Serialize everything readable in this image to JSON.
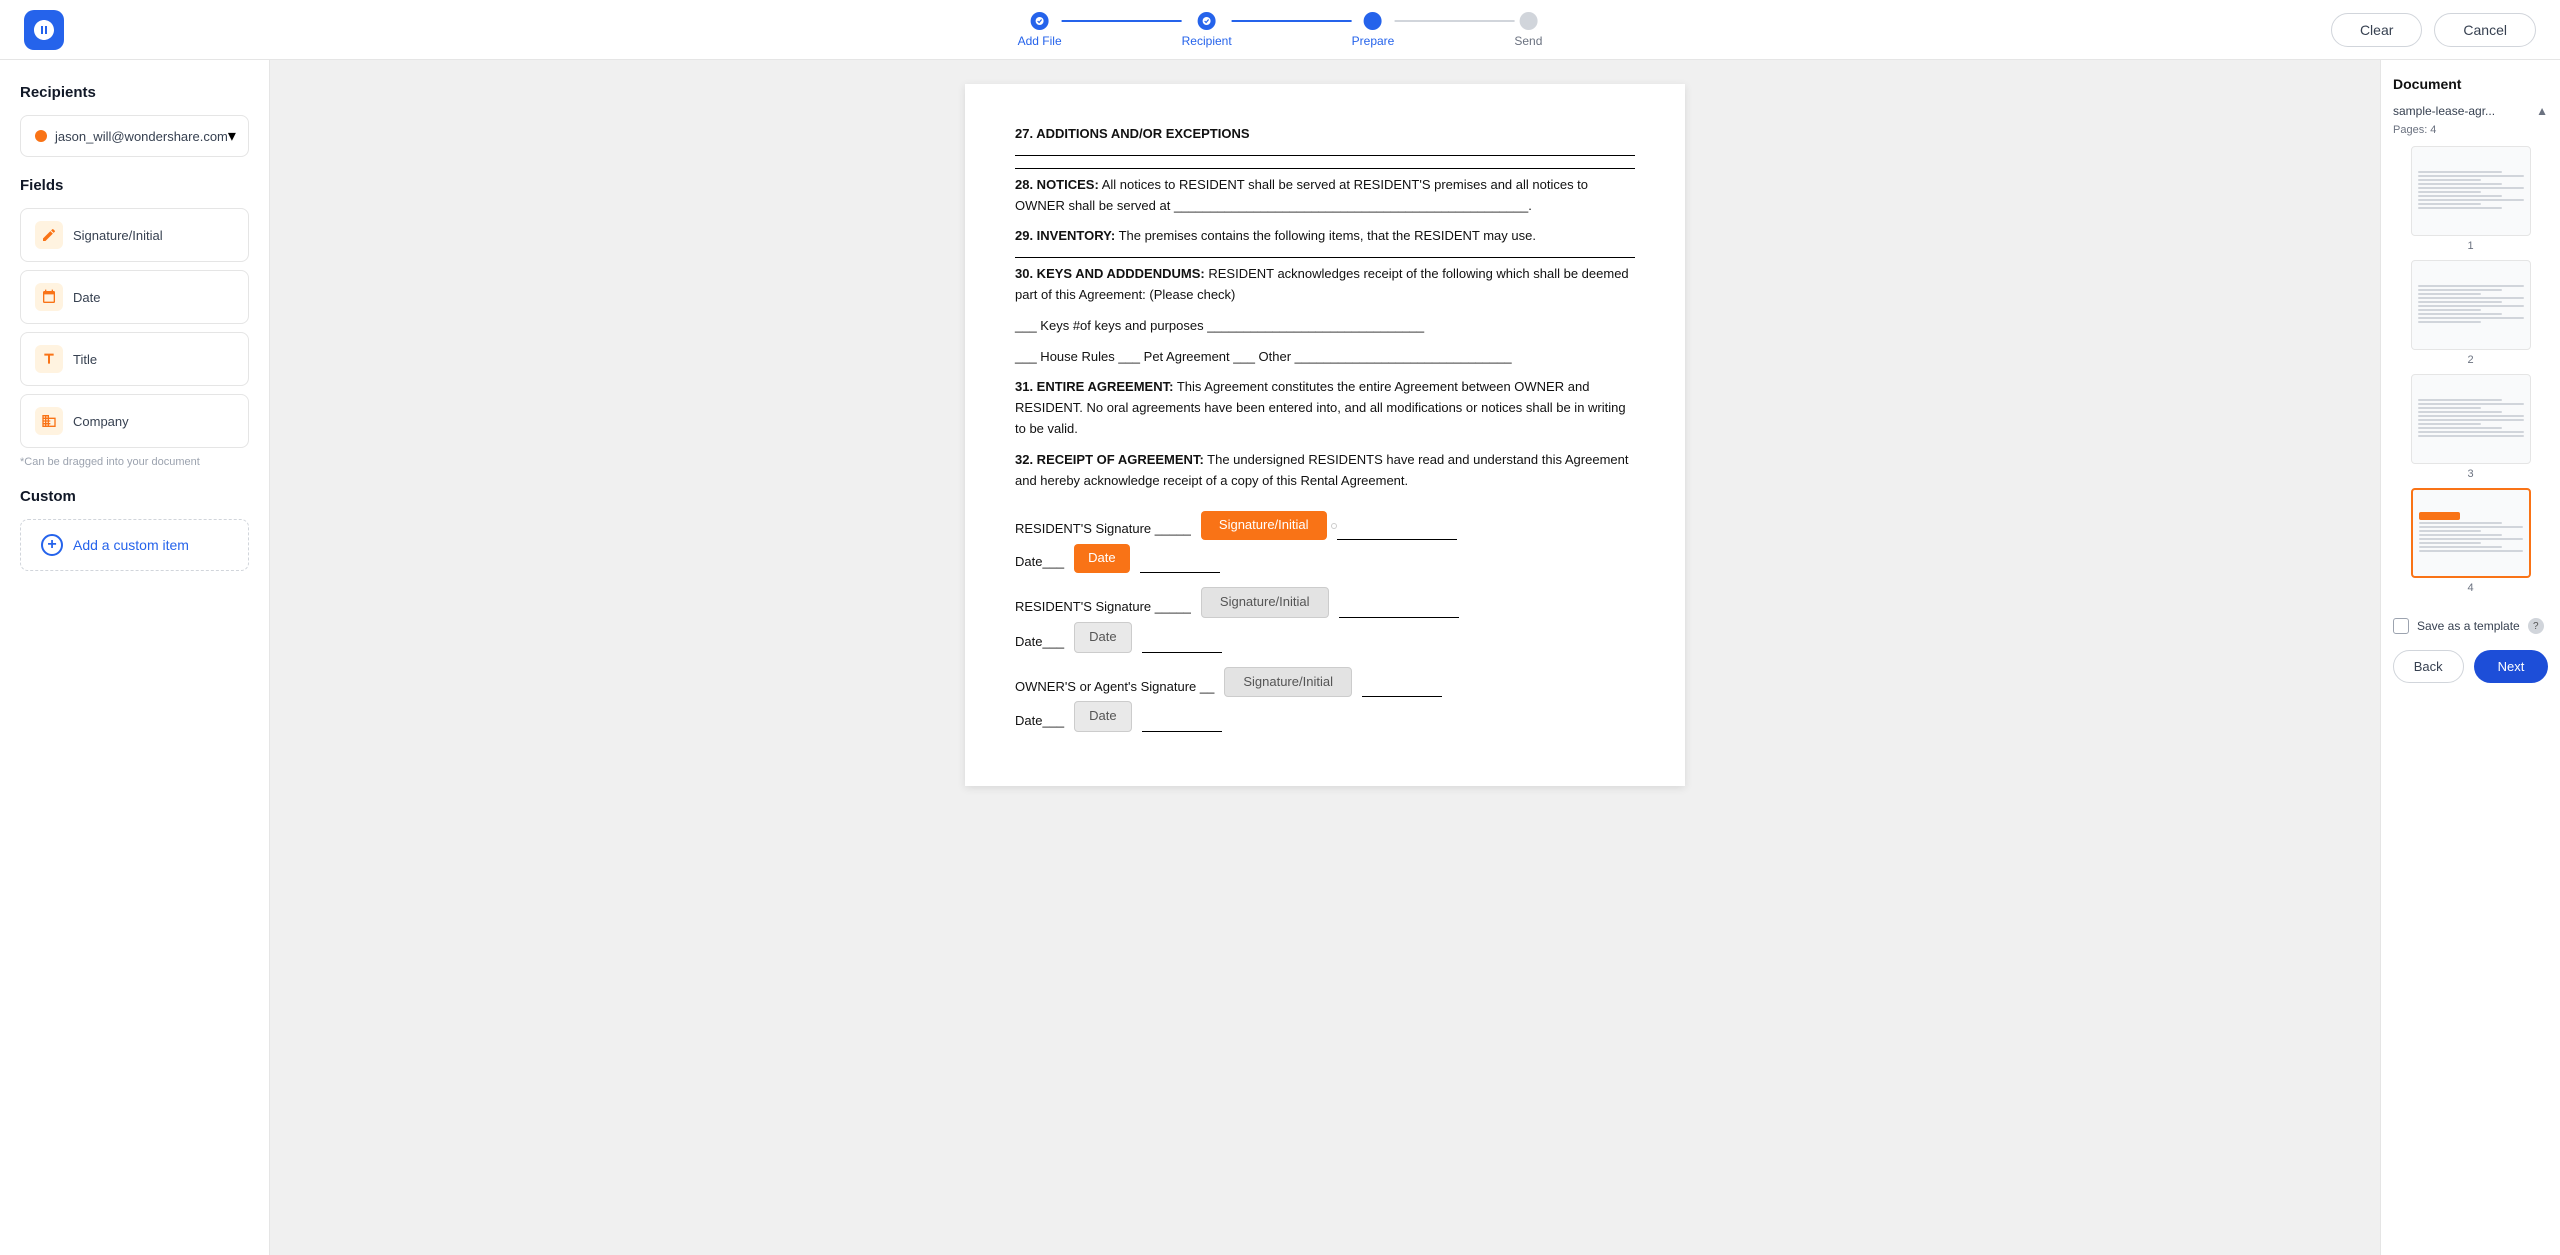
{
  "app": {
    "logo_alt": "Wondershare logo"
  },
  "steps": [
    {
      "id": "add-file",
      "label": "Add File",
      "state": "completed"
    },
    {
      "id": "recipient",
      "label": "Recipient",
      "state": "completed"
    },
    {
      "id": "prepare",
      "label": "Prepare",
      "state": "active"
    },
    {
      "id": "send",
      "label": "Send",
      "state": "inactive"
    }
  ],
  "topbar": {
    "clear_label": "Clear",
    "cancel_label": "Cancel"
  },
  "sidebar": {
    "recipients_title": "Recipients",
    "recipient_email": "jason_will@wondershare.com",
    "fields_title": "Fields",
    "fields": [
      {
        "id": "signature",
        "label": "Signature/Initial",
        "icon": "pen"
      },
      {
        "id": "date",
        "label": "Date",
        "icon": "calendar"
      },
      {
        "id": "title",
        "label": "Title",
        "icon": "tag"
      },
      {
        "id": "company",
        "label": "Company",
        "icon": "building"
      }
    ],
    "drag_hint": "*Can be dragged into your document",
    "custom_title": "Custom",
    "add_custom_label": "Add a custom item"
  },
  "document": {
    "sections": [
      {
        "num": "27",
        "heading": "ADDITIONS AND/OR EXCEPTIONS",
        "content": ""
      },
      {
        "num": "28",
        "heading": "NOTICES:",
        "content": "All notices to RESIDENT shall be served at RESIDENT'S premises and all notices to OWNER shall be served at _____________________________________."
      },
      {
        "num": "29",
        "heading": "INVENTORY:",
        "content": "The premises contains the following items, that the RESIDENT may use."
      },
      {
        "num": "30",
        "heading": "KEYS AND ADDDENDUMS:",
        "content": "RESIDENT acknowledges receipt of the following which shall be deemed part of this Agreement: (Please check)"
      },
      {
        "num": "31",
        "heading": "ENTIRE AGREEMENT:",
        "content": "This Agreement constitutes the entire Agreement between OWNER and RESIDENT. No oral agreements have been entered into, and all modifications or notices shall be in writing to be valid."
      },
      {
        "num": "32",
        "heading": "RECEIPT OF AGREEMENT:",
        "content": "The undersigned RESIDENTS have read and understand this Agreement and hereby acknowledge receipt of a copy of this Rental Agreement."
      }
    ],
    "keys_line": "___ Keys #of keys and purposes ______________________________",
    "rules_line": "___ House Rules ___ Pet Agreement ___ Other ______________________________",
    "sig_fields": {
      "active": "Signature/Initial",
      "ghost1": "Signature/Initial",
      "ghost2": "Signature/Initial"
    },
    "date_fields": {
      "active": "Date",
      "ghost1": "Date",
      "ghost2": "Date"
    },
    "resident_sig1": "RESIDENT'S Signature",
    "resident_sig2": "RESIDENT'S Signature",
    "owner_sig": "OWNER'S or Agent's Signature",
    "date_label": "Date"
  },
  "right_panel": {
    "title": "Document",
    "doc_name": "sample-lease-agr...",
    "pages_label": "Pages: 4",
    "pages": [
      {
        "num": "1",
        "active": false
      },
      {
        "num": "2",
        "active": false
      },
      {
        "num": "3",
        "active": false
      },
      {
        "num": "4",
        "active": true
      }
    ],
    "save_template_label": "Save as a template",
    "back_label": "Back",
    "next_label": "Next"
  }
}
